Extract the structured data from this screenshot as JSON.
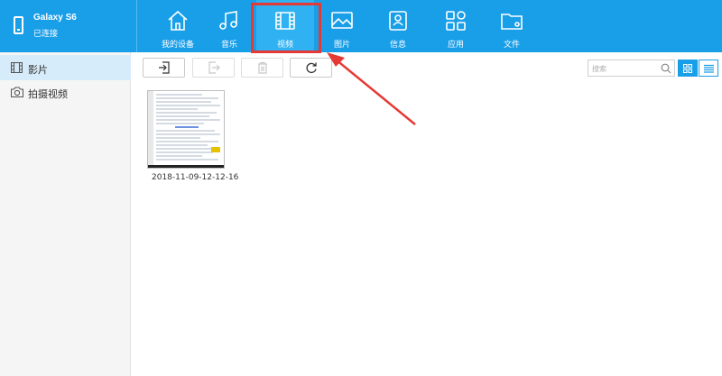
{
  "device": {
    "name": "Galaxy S6",
    "status": "已连接",
    "icon": "phone-icon"
  },
  "nav": {
    "tabs": [
      {
        "label": "我的设备",
        "icon": "home-icon"
      },
      {
        "label": "音乐",
        "icon": "music-icon"
      },
      {
        "label": "视频",
        "icon": "film-icon",
        "active": true
      },
      {
        "label": "图片",
        "icon": "image-icon"
      },
      {
        "label": "信息",
        "icon": "message-icon"
      },
      {
        "label": "应用",
        "icon": "apps-icon"
      },
      {
        "label": "文件",
        "icon": "folder-icon"
      }
    ]
  },
  "sidebar": {
    "items": [
      {
        "label": "影片",
        "icon": "film-icon",
        "active": true
      },
      {
        "label": "拍摄视频",
        "icon": "camera-icon"
      }
    ]
  },
  "toolbar": {
    "buttons": [
      {
        "icon": "import-icon",
        "enabled": true
      },
      {
        "icon": "export-icon",
        "enabled": false
      },
      {
        "icon": "trash-icon",
        "enabled": false
      },
      {
        "icon": "refresh-icon",
        "enabled": true
      }
    ]
  },
  "search": {
    "placeholder": "搜索",
    "icon": "search-icon"
  },
  "view_toggle": {
    "selected": "grid"
  },
  "videos": [
    {
      "name": "2018-11-09-12-12-16"
    }
  ],
  "colors": {
    "topbar": "#199ee8",
    "active_tab": "#2fb1f2",
    "highlight": "#e53935",
    "sidebar_active": "#d7ecfa"
  }
}
